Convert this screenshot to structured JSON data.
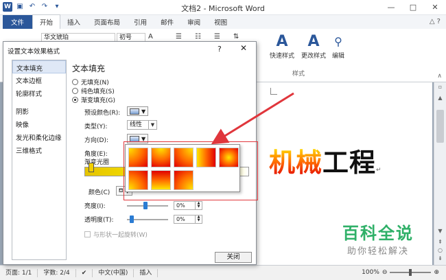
{
  "window": {
    "title": "文档2 - Microsoft Word",
    "controls": [
      "—",
      "□",
      "✕"
    ]
  },
  "ribbon": {
    "tabs": [
      "文件",
      "开始",
      "插入",
      "页面布局",
      "引用",
      "邮件",
      "审阅",
      "视图"
    ],
    "font_name": "华文琥珀",
    "font_size": "初号",
    "quick_styles_label": "快速样式",
    "change_styles_label": "更改样式",
    "styles_group_label": "样式",
    "edit_label": "编辑"
  },
  "dialog": {
    "title": "设置文本效果格式",
    "help": "?",
    "close": "✕",
    "nav_items": [
      "文本填充",
      "文本边框",
      "轮廓样式",
      "阴影",
      "映像",
      "发光和柔化边缘",
      "三维格式"
    ],
    "panel_title": "文本填充",
    "radio_none": "无填充(N)",
    "radio_solid": "纯色填充(S)",
    "radio_gradient": "渐变填充(G)",
    "preset_label": "预设颜色(R):",
    "type_label": "类型(Y):",
    "type_value": "线性",
    "direction_label": "方向(D):",
    "angle_label": "角度(E):",
    "gradient_stops_label": "渐变光圈",
    "color_label": "颜色(C)",
    "brightness_label": "亮度(I):",
    "brightness_value": "0%",
    "transparency_label": "透明度(T):",
    "transparency_value": "0%",
    "rotate_label": "与形状一起旋转(W)",
    "close_button": "关闭"
  },
  "document": {
    "art_text_gradient": "机械",
    "art_text_black": "工程",
    "paragraph_mark": "↵"
  },
  "statusbar": {
    "page": "页面: 1/1",
    "words": "字数: 2/4",
    "language": "中文(中国)",
    "mode": "插入",
    "zoom": "100%"
  },
  "watermark": {
    "main": "百科全说",
    "sub": "助你轻松解决"
  },
  "colors": {
    "word_blue": "#2b579a",
    "highlight_red": "#e0363c",
    "gradient_top": "#ffe600",
    "gradient_mid": "#ff6a00",
    "gradient_bottom": "#e00000",
    "watermark_green": "#2fb068"
  },
  "icons": {
    "app": "word-icon",
    "save": "save-icon",
    "undo": "undo-icon",
    "redo": "redo-icon",
    "help": "help-icon"
  }
}
